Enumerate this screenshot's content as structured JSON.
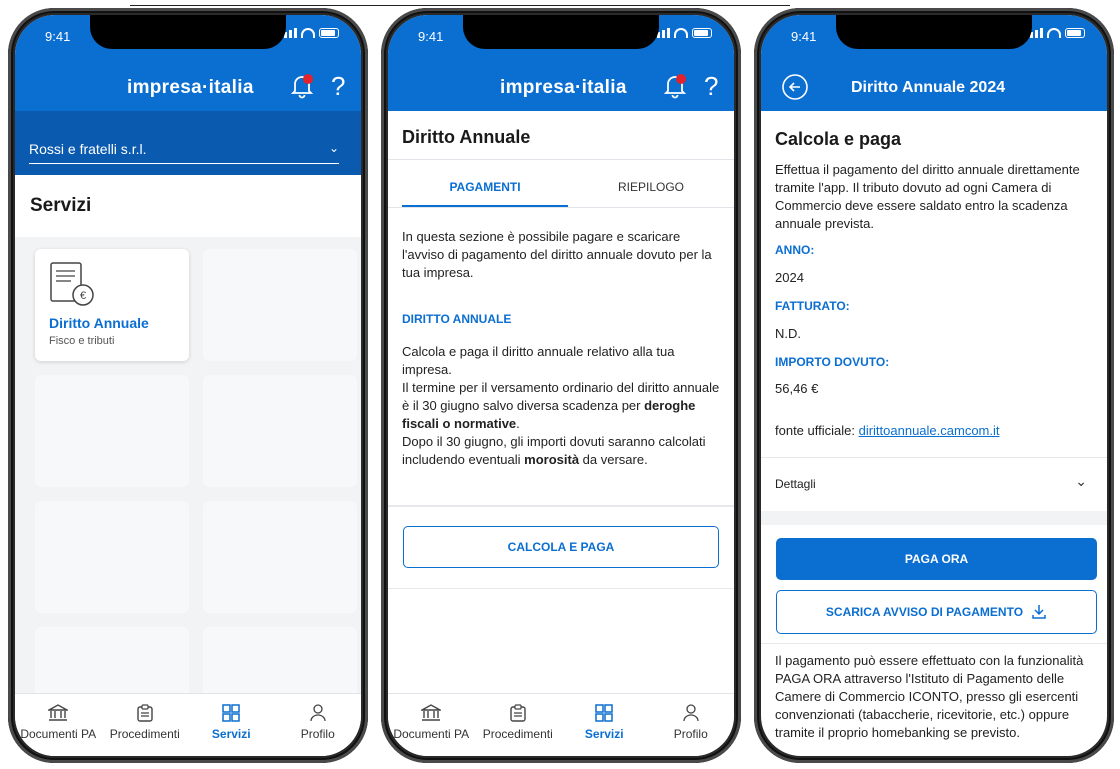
{
  "status_time": "9:41",
  "brand": {
    "logo": "impresa·italia",
    "help": "?"
  },
  "colors": {
    "primary": "#0b6ed1",
    "primary_dark": "#0a5bb0",
    "notification_dot": "#e1232d"
  },
  "tabbar": [
    {
      "label": "Documenti PA",
      "icon": "bank-icon"
    },
    {
      "label": "Procedimenti",
      "icon": "clipboard-icon"
    },
    {
      "label": "Servizi",
      "icon": "grid-icon",
      "active": true
    },
    {
      "label": "Profilo",
      "icon": "person-icon"
    }
  ],
  "screen1": {
    "company": "Rossi e fratelli s.r.l.",
    "section_title": "Servizi",
    "card": {
      "title": "Diritto Annuale",
      "subtitle": "Fisco e tributi",
      "icon": "document-euro-icon"
    }
  },
  "screen2": {
    "page_title": "Diritto Annuale",
    "tabs": [
      "PAGAMENTI",
      "RIEPILOGO"
    ],
    "active_tab": "PAGAMENTI",
    "intro": "In questa sezione è possibile pagare e scaricare l'avviso di pagamento del diritto annuale dovuto per la tua impresa.",
    "section_label": "DIRITTO ANNUALE",
    "para1": "Calcola e paga il diritto annuale relativo alla tua impresa.",
    "para2_pre": "Il termine per il versamento ordinario del diritto annuale è il 30 giugno salvo diversa scadenza per ",
    "para2_bold": "deroghe fiscali o normative",
    "para2_post": ".",
    "para3_pre": "Dopo il 30 giugno, gli importi dovuti saranno calcolati includendo eventuali ",
    "para3_bold": "morosità",
    "para3_post": " da versare.",
    "button": "CALCOLA E PAGA"
  },
  "screen3": {
    "header_title": "Diritto Annuale 2024",
    "page_title": "Calcola e paga",
    "description": "Effettua il pagamento del diritto annuale direttamente tramite l'app. Il tributo dovuto ad ogni Camera di Commercio deve essere saldato entro la scadenza annuale prevista.",
    "fields": [
      {
        "label": "ANNO:",
        "value": "2024"
      },
      {
        "label": "FATTURATO:",
        "value": "N.D."
      },
      {
        "label": "IMPORTO DOVUTO:",
        "value": "56,46 €"
      }
    ],
    "source_label": "fonte ufficiale: ",
    "source_link": "dirittoannuale.camcom.it",
    "details_label": "Dettagli",
    "pay_button": "PAGA ORA",
    "download_button": "SCARICA AVVISO DI PAGAMENTO",
    "footer_text": "Il pagamento può essere effettuato con la funzionalità PAGA ORA attraverso l'Istituto di Pagamento delle Camere di Commercio ICONTO, presso gli esercenti convenzionati (tabaccherie, ricevitorie, etc.) oppure tramite il proprio homebanking se previsto."
  }
}
